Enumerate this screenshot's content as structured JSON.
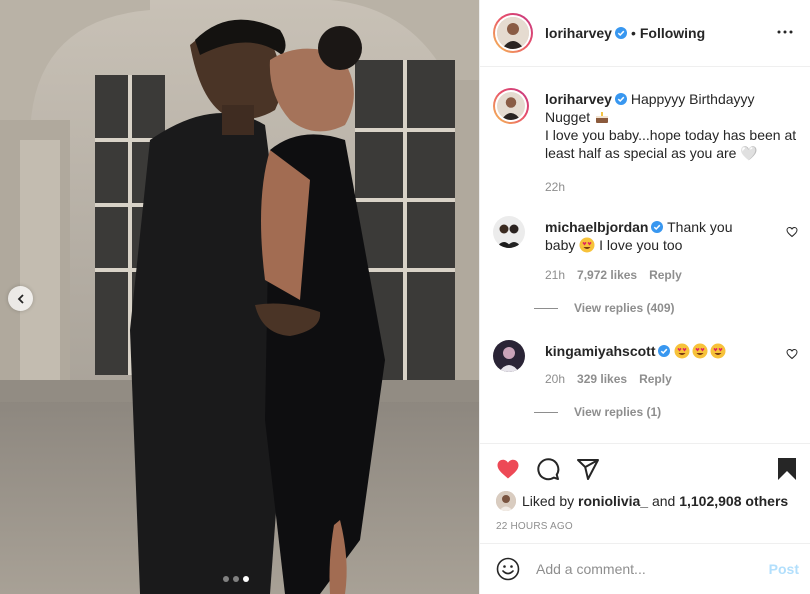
{
  "post": {
    "author": "loriharvey",
    "follow_state": "Following",
    "separator": "•",
    "carousel": {
      "count": 3,
      "active_index": 2
    }
  },
  "caption": {
    "username": "loriharvey",
    "text_line1": "Happyyy Birthdayyy",
    "text_line2": "Nugget",
    "text_line3": "I love you baby...hope today has been at least half as special as you are",
    "emoji_end": "🤍",
    "time": "22h"
  },
  "comments": [
    {
      "username": "michaelbjordan",
      "text_a": "Thank you",
      "text_b": "baby",
      "text_c": "I love you too",
      "time": "21h",
      "likes": "7,972 likes",
      "reply_label": "Reply",
      "view_replies": "View replies (409)"
    },
    {
      "username": "kingamiyahscott",
      "text_a": "",
      "time": "20h",
      "likes": "329 likes",
      "reply_label": "Reply",
      "view_replies": "View replies (1)"
    }
  ],
  "likes": {
    "prefix": "Liked by",
    "first_user": "roniolivia_",
    "conj": "and",
    "others": "1,102,908 others"
  },
  "timestamp": "22 HOURS AGO",
  "add_comment": {
    "placeholder": "Add a comment...",
    "post_label": "Post"
  },
  "colors": {
    "like_red": "#ed4956",
    "verified_blue": "#3897f0",
    "post_disabled": "#b2dffc",
    "muted": "#8e8e8e"
  }
}
